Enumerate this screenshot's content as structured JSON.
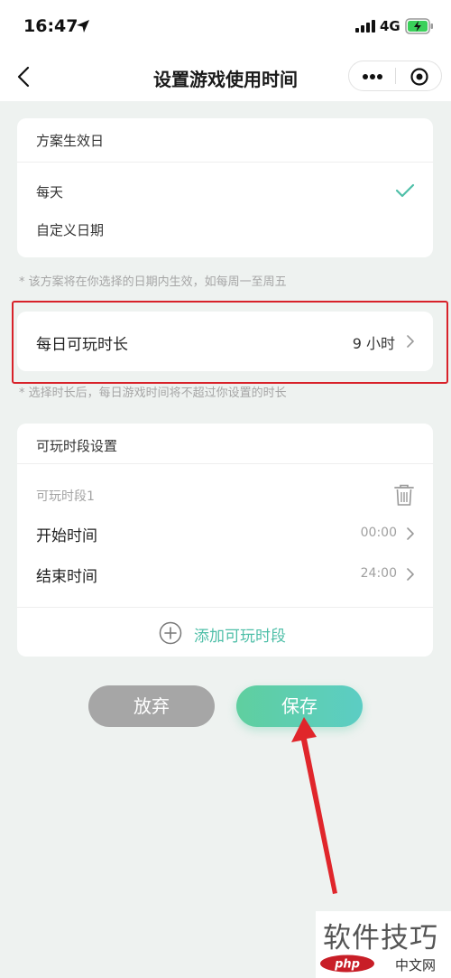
{
  "status": {
    "time": "16:47",
    "network": "4G"
  },
  "nav": {
    "title": "设置游戏使用时间"
  },
  "effective_days": {
    "header": "方案生效日",
    "options": [
      {
        "label": "每天",
        "selected": true
      },
      {
        "label": "自定义日期",
        "selected": false
      }
    ],
    "hint": "* 该方案将在你选择的日期内生效，如每周一至周五"
  },
  "daily_duration": {
    "label": "每日可玩时长",
    "value": "9 小时",
    "hint": "* 选择时长后，每日游戏时间将不超过你设置的时长"
  },
  "periods": {
    "header": "可玩时段设置",
    "items": [
      {
        "name": "可玩时段1",
        "start_label": "开始时间",
        "start_value": "00:00",
        "end_label": "结束时间",
        "end_value": "24:00"
      }
    ],
    "add_label": "添加可玩时段"
  },
  "actions": {
    "give_up": "放弃",
    "save": "保存"
  },
  "colors": {
    "accent": "#4fbfa8",
    "highlight": "#d8222a",
    "arrow": "#e0262b"
  },
  "watermark": {
    "text": "软件技巧",
    "logo_text": "php",
    "sub": "中文网"
  }
}
